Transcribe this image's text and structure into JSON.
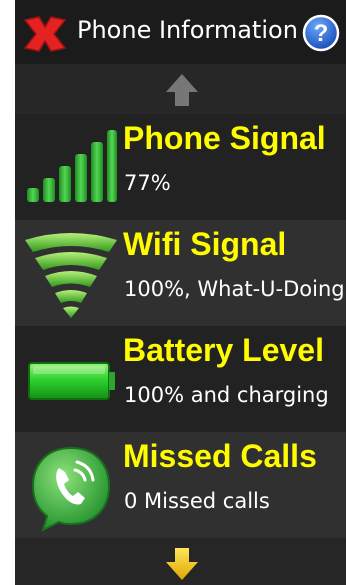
{
  "header": {
    "title": "Phone Information",
    "close_icon": "close-x-icon",
    "help_icon": "help-question-icon"
  },
  "navigation": {
    "up_icon": "arrow-up-icon",
    "down_icon": "arrow-down-icon"
  },
  "items": [
    {
      "title": "Phone Signal",
      "value": "77%",
      "icon": "signal-bars-icon"
    },
    {
      "title": "Wifi Signal",
      "value": "100%, What-U-Doing",
      "icon": "wifi-icon"
    },
    {
      "title": "Battery Level",
      "value": "100% and charging",
      "icon": "battery-icon"
    },
    {
      "title": "Missed Calls",
      "value": "0 Missed calls",
      "icon": "phone-call-icon"
    }
  ],
  "colors": {
    "title_yellow": "#fffc00",
    "close_red": "#e52222",
    "help_blue": "#1f5fcf",
    "signal_green": "#2bb82b",
    "down_arrow_yellow": "#f3c300"
  }
}
